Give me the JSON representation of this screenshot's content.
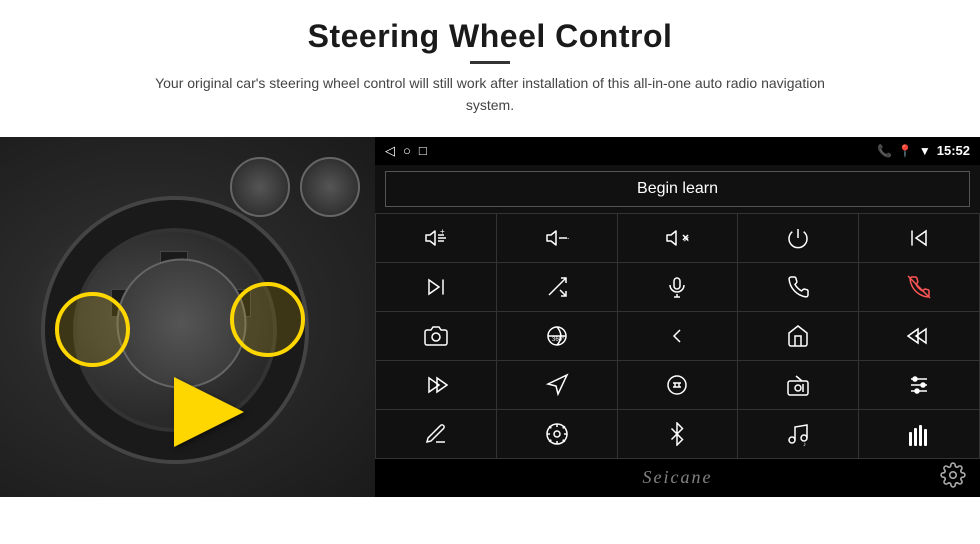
{
  "header": {
    "title": "Steering Wheel Control",
    "subtitle": "Your original car's steering wheel control will still work after installation of this all-in-one auto radio navigation system."
  },
  "status_bar": {
    "time": "15:52",
    "nav_back": "◁",
    "nav_home": "○",
    "nav_recent": "□"
  },
  "begin_learn_label": "Begin learn",
  "controls": [
    {
      "icon": "vol-up",
      "label": "Volume Up"
    },
    {
      "icon": "vol-down",
      "label": "Volume Down"
    },
    {
      "icon": "vol-mute",
      "label": "Volume Mute"
    },
    {
      "icon": "power",
      "label": "Power"
    },
    {
      "icon": "prev-track",
      "label": "Previous Track"
    },
    {
      "icon": "next-track",
      "label": "Next Track / Skip"
    },
    {
      "icon": "shuffle",
      "label": "Shuffle"
    },
    {
      "icon": "mic",
      "label": "Microphone"
    },
    {
      "icon": "phone",
      "label": "Phone"
    },
    {
      "icon": "hang-up",
      "label": "Hang Up"
    },
    {
      "icon": "camera",
      "label": "Camera"
    },
    {
      "icon": "360",
      "label": "360 View"
    },
    {
      "icon": "back",
      "label": "Back"
    },
    {
      "icon": "home",
      "label": "Home"
    },
    {
      "icon": "skip-back",
      "label": "Skip Back"
    },
    {
      "icon": "fast-forward",
      "label": "Fast Forward"
    },
    {
      "icon": "navigate",
      "label": "Navigate"
    },
    {
      "icon": "eq",
      "label": "Equalizer"
    },
    {
      "icon": "radio",
      "label": "Radio"
    },
    {
      "icon": "adjust",
      "label": "Adjust"
    },
    {
      "icon": "pen",
      "label": "Pen"
    },
    {
      "icon": "settings-circle",
      "label": "Settings"
    },
    {
      "icon": "bluetooth",
      "label": "Bluetooth"
    },
    {
      "icon": "music",
      "label": "Music"
    },
    {
      "icon": "sound-bars",
      "label": "Sound Bars"
    }
  ],
  "bottom": {
    "brand": "Seicane"
  }
}
